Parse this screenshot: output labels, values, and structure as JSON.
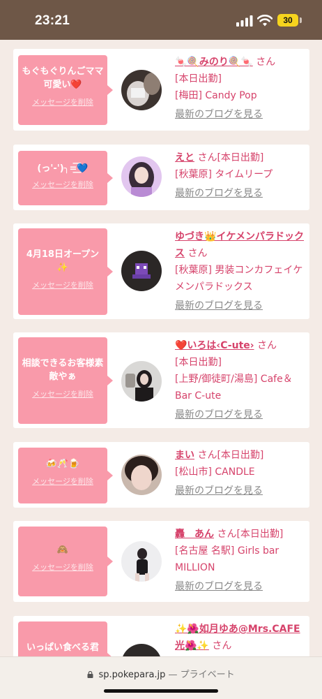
{
  "status_bar": {
    "time": "23:21",
    "battery": "30"
  },
  "common": {
    "delete_label": "メッセージを削除",
    "blog_label": "最新のブログを見る",
    "san": "さん"
  },
  "cards": [
    {
      "message": "もぐもぐりんごママ可愛い❤️",
      "name": "🍬🍭みのり🍭🍬",
      "badge": "[本日出勤]",
      "shop": "[梅田] Candy Pop"
    },
    {
      "message": "(っ'-')╮=͟͟͞͞💙",
      "name": "えと",
      "badge": "[本日出勤]",
      "shop": "[秋葉原] タイムリープ"
    },
    {
      "message": "4月18日オープン✨",
      "name": "ゆづき👑イケメンパラドックス",
      "badge": "",
      "shop": "[秋葉原] 男装コンカフェイケメンパラドックス"
    },
    {
      "message": "相談できるお客様素敵やぁ",
      "name": "❤️いろは‹C-ute›",
      "badge": "[本日出勤]",
      "shop": "[上野/御徒町/湯島] Cafe＆Bar C-ute"
    },
    {
      "message": "🍻🥂🍺",
      "name": "まい",
      "badge": "[本日出勤]",
      "shop": "[松山市] CANDLE"
    },
    {
      "message": "🙈",
      "name": "轟　あん",
      "badge": "[本日出勤]",
      "shop": "[名古屋 名駅] Girls bar MILLION"
    },
    {
      "message": "いっぱい食べる君",
      "name": "✨🌺如月ゆあ@Mrs.CAFE光🌺✨",
      "badge": "",
      "shop": ""
    }
  ],
  "browser": {
    "url": "sp.pokepara.jp",
    "separator": " — ",
    "private_label": "プライベート"
  }
}
